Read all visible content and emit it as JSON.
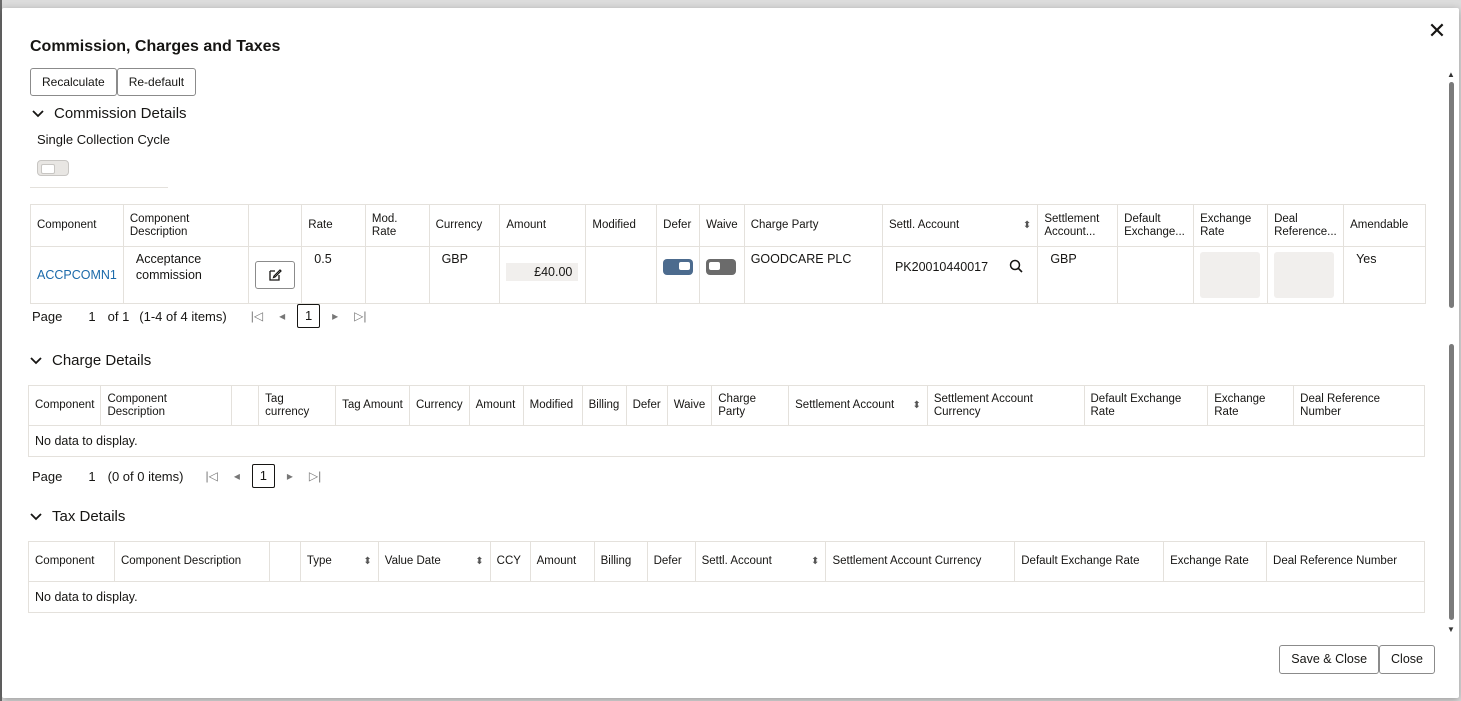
{
  "dialog": {
    "title": "Commission, Charges and Taxes",
    "close_icon": "close-icon"
  },
  "toolbar": {
    "recalculate_label": "Recalculate",
    "redefault_label": "Re-default"
  },
  "commission": {
    "section_title": "Commission Details",
    "single_collection_label": "Single Collection Cycle",
    "single_collection_on": false,
    "headers": [
      "Component",
      "Component Description",
      "",
      "Rate",
      "Mod. Rate",
      "Currency",
      "Amount",
      "Modified",
      "Defer",
      "Waive",
      "Charge Party",
      "Settl. Account",
      "Settlement Account...",
      "Default Exchange...",
      "Exchange Rate",
      "Deal Reference...",
      "Amendable"
    ],
    "row": {
      "component": "ACCPCOMN1",
      "description": "Acceptance commission",
      "rate": "0.5",
      "mod_rate": "",
      "currency": "GBP",
      "amount": "£40.00",
      "modified": "",
      "defer_on": true,
      "waive_on": false,
      "charge_party": "GOODCARE PLC",
      "settl_account": "PK20010440017",
      "settlement_account_ccy": "GBP",
      "default_exchange": "",
      "amendable": "Yes"
    },
    "pager": {
      "page_label": "Page",
      "page": "1",
      "of": "of 1",
      "items": "(1-4 of 4 items)",
      "current": "1"
    }
  },
  "charges": {
    "section_title": "Charge Details",
    "headers": [
      "Component",
      "Component Description",
      "",
      "Tag currency",
      "Tag Amount",
      "Currency",
      "Amount",
      "Modified",
      "Billing",
      "Defer",
      "Waive",
      "Charge Party",
      "Settlement Account",
      "Settlement Account Currency",
      "Default Exchange Rate",
      "Exchange Rate",
      "Deal Reference Number"
    ],
    "empty_text": "No data to display.",
    "pager": {
      "page_label": "Page",
      "page": "1",
      "items": "(0 of 0 items)",
      "current": "1"
    }
  },
  "taxes": {
    "section_title": "Tax Details",
    "headers": [
      "Component",
      "Component Description",
      "",
      "Type",
      "Value Date",
      "CCY",
      "Amount",
      "Billing",
      "Defer",
      "Settl. Account",
      "Settlement Account Currency",
      "Default Exchange Rate",
      "Exchange Rate",
      "Deal Reference Number"
    ],
    "empty_text": "No data to display."
  },
  "footer": {
    "save_close_label": "Save & Close",
    "close_label": "Close"
  },
  "colors": {
    "link": "#1b6aaa",
    "toggle_on": "#4c6b8e"
  }
}
